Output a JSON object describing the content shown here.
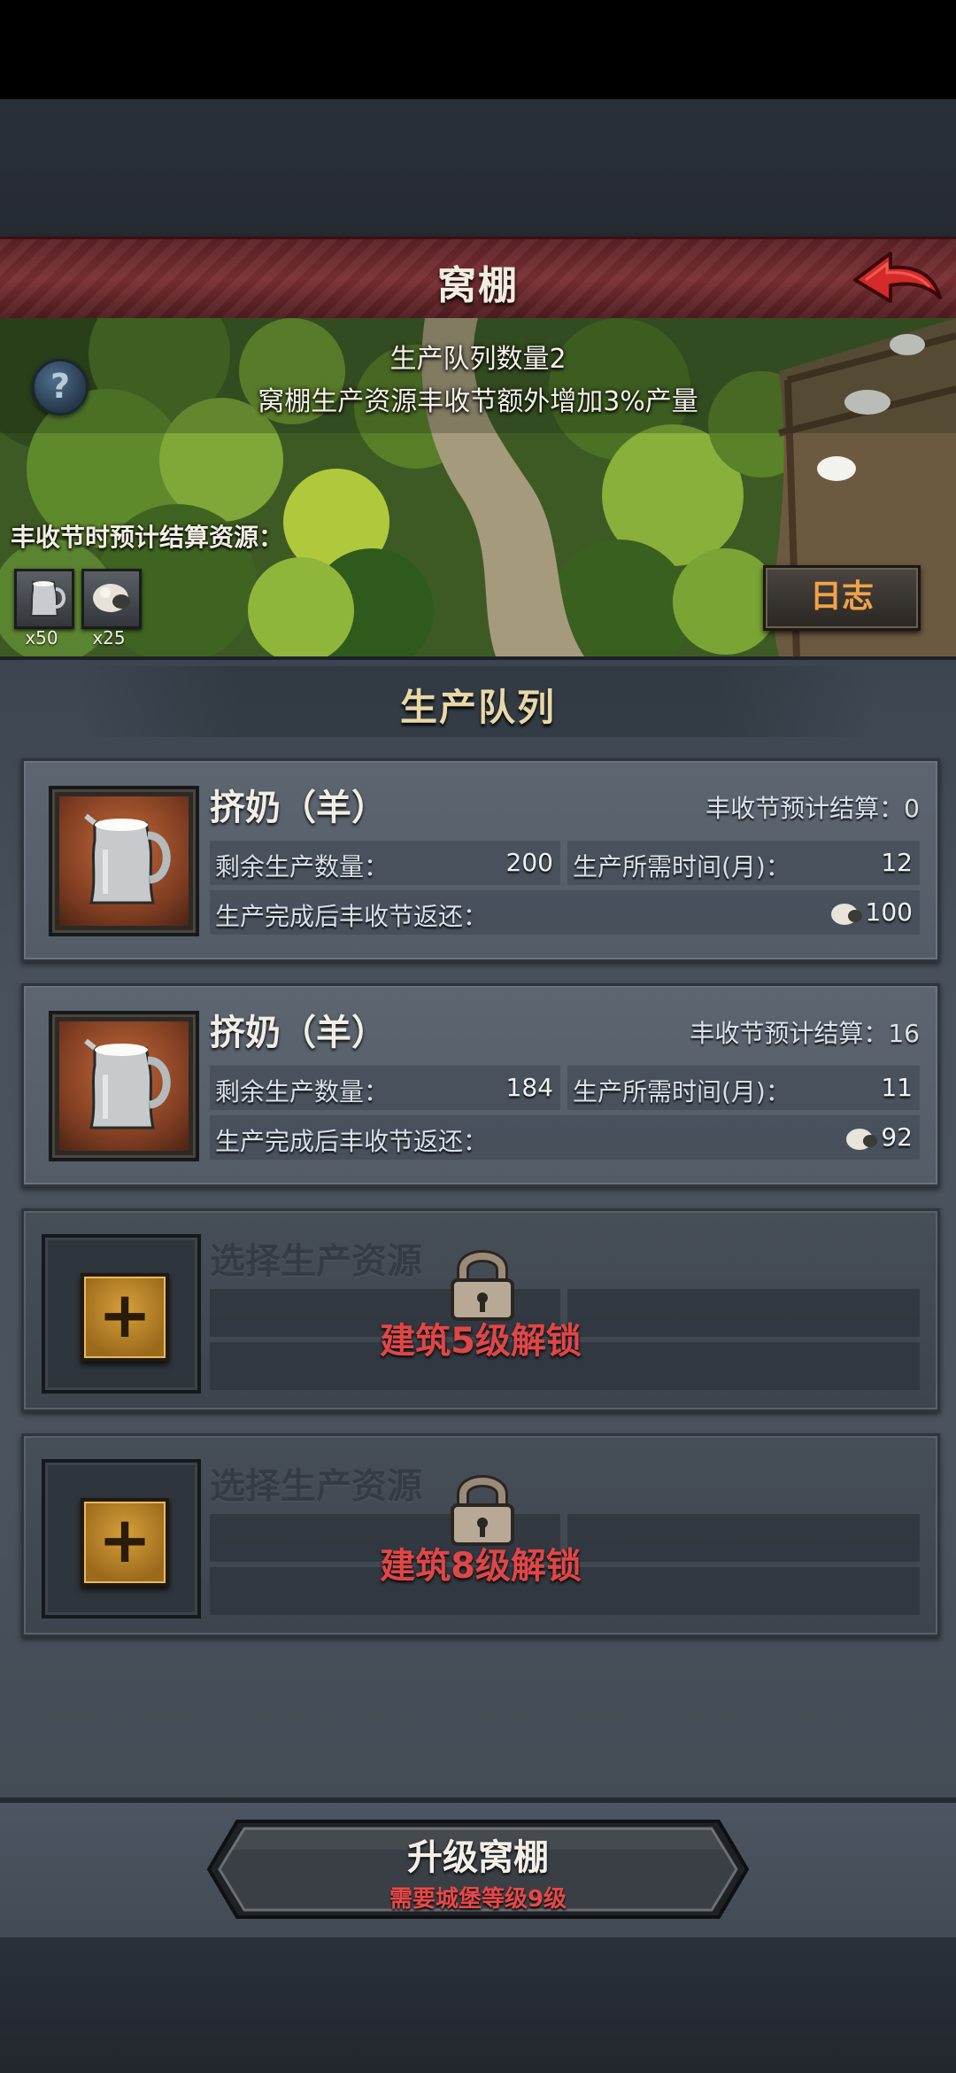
{
  "header": {
    "title": "窝棚"
  },
  "banner": {
    "queue_count_text": "生产队列数量2",
    "bonus_text": "窝棚生产资源丰收节额外增加3%产量",
    "help_label": "?",
    "resources_label": "丰收节时预计结算资源：",
    "resources": [
      {
        "icon": "milk-jug-icon",
        "count": "x50"
      },
      {
        "icon": "sheep-icon",
        "count": "x25"
      }
    ],
    "log_button": "日志"
  },
  "queue": {
    "title": "生产队列",
    "items": [
      {
        "name": "挤奶（羊）",
        "forecast": "丰收节预计结算：0",
        "remaining_label": "剩余生产数量：",
        "remaining_value": "200",
        "time_label": "生产所需时间(月)：",
        "time_value": "12",
        "return_label": "生产完成后丰收节返还：",
        "return_value": "100"
      },
      {
        "name": "挤奶（羊）",
        "forecast": "丰收节预计结算：16",
        "remaining_label": "剩余生产数量：",
        "remaining_value": "184",
        "time_label": "生产所需时间(月)：",
        "time_value": "11",
        "return_label": "生产完成后丰收节返还：",
        "return_value": "92"
      }
    ],
    "locked_slots": [
      {
        "title": "选择生产资源",
        "unlock_text": "建筑5级解锁",
        "plus": "+"
      },
      {
        "title": "选择生产资源",
        "unlock_text": "建筑8级解锁",
        "plus": "+"
      }
    ]
  },
  "footer": {
    "upgrade_label": "升级窝棚",
    "upgrade_requirement": "需要城堡等级9级"
  },
  "colors": {
    "title_bar": "#7a2f33",
    "back_arrow": "#d42a2a",
    "log_text": "#f0a24a",
    "unlock_text": "#e04646",
    "section_title": "#e8d8a8"
  }
}
